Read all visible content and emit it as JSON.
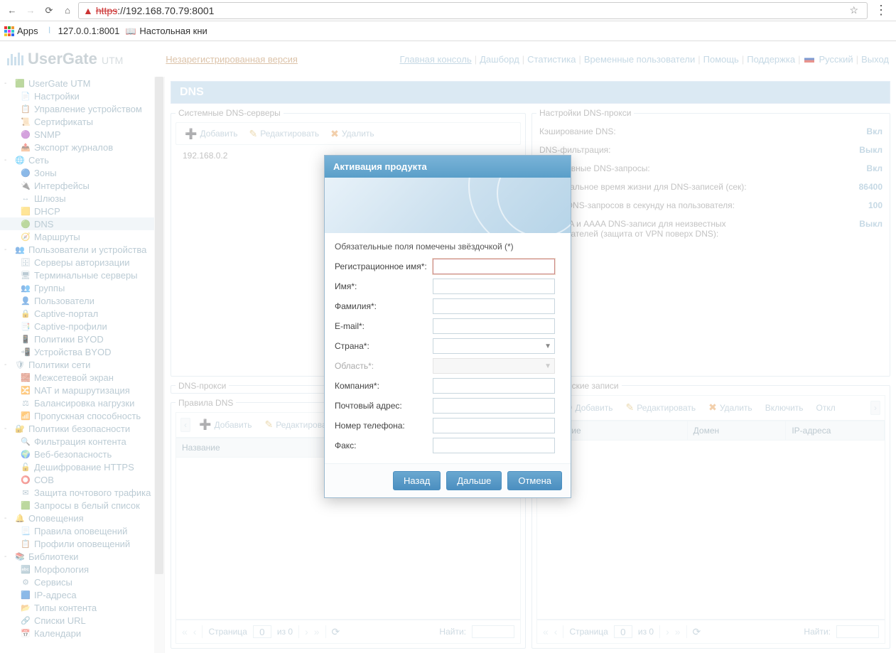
{
  "browser": {
    "url_scheme": "https",
    "url_rest": "://192.168.70.79:8001",
    "bookmarks": {
      "apps": "Apps",
      "local": "127.0.0.1:8001",
      "book": "Настольная кни"
    }
  },
  "header": {
    "logo_main": "UserGate",
    "logo_sub": "UTM",
    "unreg": "Незарегистрированная версия",
    "links": {
      "console": "Главная консоль",
      "dashboard": "Дашборд",
      "stats": "Статистика",
      "temp_users": "Временные пользователи",
      "help": "Помощь",
      "support": "Поддержка",
      "lang": "Русский",
      "logout": "Выход"
    }
  },
  "sidebar": [
    {
      "lvl": 0,
      "icon": "🟩",
      "label": "UserGate UTM",
      "exp": "-"
    },
    {
      "lvl": 1,
      "icon": "📄",
      "label": "Настройки"
    },
    {
      "lvl": 1,
      "icon": "📋",
      "label": "Управление устройством"
    },
    {
      "lvl": 1,
      "icon": "📜",
      "label": "Сертификаты"
    },
    {
      "lvl": 1,
      "icon": "🟣",
      "label": "SNMP"
    },
    {
      "lvl": 1,
      "icon": "📤",
      "label": "Экспорт журналов"
    },
    {
      "lvl": 0,
      "icon": "🌐",
      "label": "Сеть",
      "exp": "-"
    },
    {
      "lvl": 1,
      "icon": "🔵",
      "label": "Зоны"
    },
    {
      "lvl": 1,
      "icon": "🔌",
      "label": "Интерфейсы"
    },
    {
      "lvl": 1,
      "icon": "↔",
      "label": "Шлюзы"
    },
    {
      "lvl": 1,
      "icon": "🟨",
      "label": "DHCP"
    },
    {
      "lvl": 1,
      "icon": "🟢",
      "label": "DNS",
      "selected": true
    },
    {
      "lvl": 1,
      "icon": "🧭",
      "label": "Маршруты"
    },
    {
      "lvl": 0,
      "icon": "👥",
      "label": "Пользователи и устройства",
      "exp": "-"
    },
    {
      "lvl": 1,
      "icon": "🗄",
      "label": "Серверы авторизации"
    },
    {
      "lvl": 1,
      "icon": "🖥",
      "label": "Терминальные серверы"
    },
    {
      "lvl": 1,
      "icon": "👥",
      "label": "Группы"
    },
    {
      "lvl": 1,
      "icon": "👤",
      "label": "Пользователи"
    },
    {
      "lvl": 1,
      "icon": "🔒",
      "label": "Captive-портал"
    },
    {
      "lvl": 1,
      "icon": "📑",
      "label": "Captive-профили"
    },
    {
      "lvl": 1,
      "icon": "📱",
      "label": "Политики BYOD"
    },
    {
      "lvl": 1,
      "icon": "📲",
      "label": "Устройства BYOD"
    },
    {
      "lvl": 0,
      "icon": "🛡",
      "label": "Политики сети",
      "exp": "-"
    },
    {
      "lvl": 1,
      "icon": "🧱",
      "label": "Межсетевой экран"
    },
    {
      "lvl": 1,
      "icon": "🔀",
      "label": "NAT и маршрутизация"
    },
    {
      "lvl": 1,
      "icon": "⚖",
      "label": "Балансировка нагрузки"
    },
    {
      "lvl": 1,
      "icon": "📶",
      "label": "Пропускная способность"
    },
    {
      "lvl": 0,
      "icon": "🔐",
      "label": "Политики безопасности",
      "exp": "-"
    },
    {
      "lvl": 1,
      "icon": "🔍",
      "label": "Фильтрация контента"
    },
    {
      "lvl": 1,
      "icon": "🌍",
      "label": "Веб-безопасность"
    },
    {
      "lvl": 1,
      "icon": "🔓",
      "label": "Дешифрование HTTPS"
    },
    {
      "lvl": 1,
      "icon": "⭕",
      "label": "СОВ"
    },
    {
      "lvl": 1,
      "icon": "✉",
      "label": "Защита почтового трафика"
    },
    {
      "lvl": 1,
      "icon": "🟩",
      "label": "Запросы в белый список"
    },
    {
      "lvl": 0,
      "icon": "🔔",
      "label": "Оповещения",
      "exp": "-"
    },
    {
      "lvl": 1,
      "icon": "📃",
      "label": "Правила оповещений"
    },
    {
      "lvl": 1,
      "icon": "📋",
      "label": "Профили оповещений"
    },
    {
      "lvl": 0,
      "icon": "📚",
      "label": "Библиотеки",
      "exp": "-"
    },
    {
      "lvl": 1,
      "icon": "🔤",
      "label": "Морфология"
    },
    {
      "lvl": 1,
      "icon": "⚙",
      "label": "Сервисы"
    },
    {
      "lvl": 1,
      "icon": "🟦",
      "label": "IP-адреса"
    },
    {
      "lvl": 1,
      "icon": "📂",
      "label": "Типы контента"
    },
    {
      "lvl": 1,
      "icon": "🔗",
      "label": "Списки URL"
    },
    {
      "lvl": 1,
      "icon": "📅",
      "label": "Календари"
    }
  ],
  "main": {
    "page_title": "DNS",
    "panels": {
      "dns_servers": {
        "legend": "Системные DNS-серверы",
        "toolbar": {
          "add": "Добавить",
          "edit": "Редактировать",
          "del": "Удалить"
        },
        "row0": "192.168.0.2"
      },
      "dns_proxy_settings": {
        "legend": "Настройки DNS-прокси",
        "rows": [
          {
            "k": "Кэширование DNS:",
            "v": "Вкл"
          },
          {
            "k": "DNS-фильтрация:",
            "v": "Выкл"
          },
          {
            "k": "Рекурсивные DNS-запросы:",
            "v": "Вкл"
          },
          {
            "k": "Максимальное время жизни для DNS-записей (сек):",
            "v": "86400"
          },
          {
            "k": "Лимит DNS-запросов в секунду на пользователя:",
            "v": "100"
          },
          {
            "k": "Только A и AAAA DNS-записи для неизвестных пользователей (защита от VPN поверх DNS):",
            "v": "Выкл"
          }
        ]
      },
      "dns_proxy": {
        "legend": "DNS-прокси"
      },
      "dns_rules": {
        "legend": "Правила DNS",
        "toolbar": {
          "add": "Добавить",
          "edit": "Редактировать"
        },
        "col0": "Название"
      },
      "static_records": {
        "legend": "Статические записи",
        "toolbar": {
          "add": "Добавить",
          "edit": "Редактировать",
          "del": "Удалить",
          "enable": "Включить",
          "disable": "Откл"
        },
        "cols": {
          "name": "Название",
          "domain": "Домен",
          "ip": "IP-адреса"
        }
      }
    },
    "paging": {
      "page_label": "Страница",
      "page": "0",
      "of": "из 0",
      "find": "Найти:"
    }
  },
  "modal": {
    "title": "Активация продукта",
    "req_note": "Обязательные поля помечены звёздочкой (*)",
    "fields": {
      "reg_name": "Регистрационное имя*:",
      "first": "Имя*:",
      "last": "Фамилия*:",
      "email": "E-mail*:",
      "country": "Страна*:",
      "region": "Область*:",
      "company": "Компания*:",
      "address": "Почтовый адрес:",
      "phone": "Номер телефона:",
      "fax": "Факс:"
    },
    "buttons": {
      "back": "Назад",
      "next": "Дальше",
      "cancel": "Отмена"
    }
  }
}
